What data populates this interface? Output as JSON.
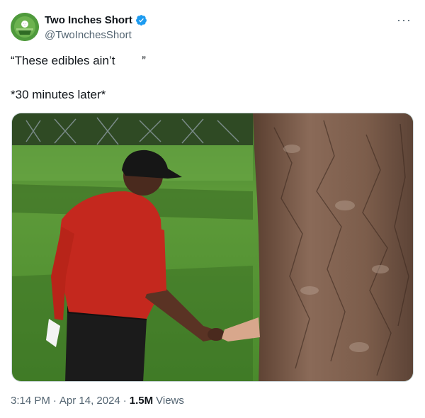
{
  "account": {
    "name": "Two Inches Short",
    "handle": "@TwoInchesShort",
    "avatar_icon": "golf-ball-logo-icon",
    "verified_icon": "verified-badge-icon",
    "verified_color": "#1d9bf0"
  },
  "more_menu": "···",
  "tweet": {
    "line1": "“These edibles ain’t        ”",
    "line2": "*30 minutes later*"
  },
  "media": {
    "description_icon": "golfer-shaking-hand-from-tree-photo"
  },
  "meta": {
    "time": "3:14 PM",
    "sep1": "·",
    "date": "Apr 14, 2024",
    "sep2": "·",
    "views_count": "1.5M",
    "views_label": "Views"
  },
  "colors": {
    "text_primary": "#0f1419",
    "text_secondary": "#536471",
    "grass": "#4e8a2e",
    "shirt": "#c4281e",
    "bark": "#7a5a46"
  }
}
